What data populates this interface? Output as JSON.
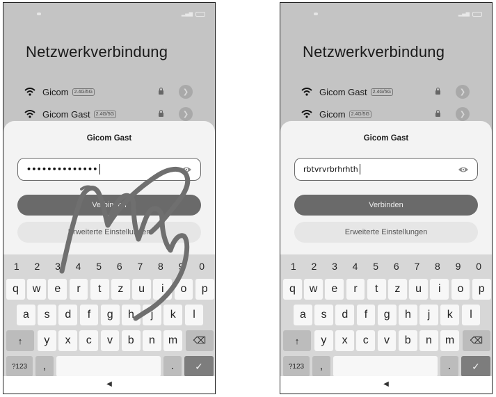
{
  "phones": [
    {
      "title": "Netzwerkverbindung",
      "networks": [
        {
          "name": "Gicom",
          "badge": "2.4G/5G"
        },
        {
          "name": "Gicom Gast",
          "badge": "2.4G/5G"
        }
      ],
      "dialog": {
        "network_title": "Gicom Gast",
        "password_value": "••••••••••••••",
        "connect_label": "Verbinden",
        "advanced_label": "Erweiterte Einstellungen"
      }
    },
    {
      "title": "Netzwerkverbindung",
      "networks": [
        {
          "name": "Gicom Gast",
          "badge": "2.4G/5G"
        },
        {
          "name": "Gicom",
          "badge": "2.4G/5G"
        }
      ],
      "dialog": {
        "network_title": "Gicom Gast",
        "password_value": "rbtvrvrbrhrhth",
        "connect_label": "Verbinden",
        "advanced_label": "Erweiterte Einstellungen"
      }
    }
  ],
  "keyboard": {
    "digits": [
      "1",
      "2",
      "3",
      "4",
      "5",
      "6",
      "7",
      "8",
      "9",
      "0"
    ],
    "row1": [
      "q",
      "w",
      "e",
      "r",
      "t",
      "z",
      "u",
      "i",
      "o",
      "p"
    ],
    "row2": [
      "a",
      "s",
      "d",
      "f",
      "g",
      "h",
      "j",
      "k",
      "l"
    ],
    "row3": [
      "y",
      "x",
      "c",
      "v",
      "b",
      "n",
      "m"
    ],
    "shift_symbol": "↑",
    "backspace_symbol": "⌫",
    "symbols_label": "?123",
    "comma_label": ",",
    "period_label": ".",
    "enter_symbol": "✓"
  },
  "nav": {
    "back_symbol": "◀"
  },
  "colors": {
    "screen_dim": "#c4c4c4",
    "sheet": "#f3f3f3",
    "primary_button": "#6a6a6a",
    "gesture": "#6f6f6f"
  }
}
